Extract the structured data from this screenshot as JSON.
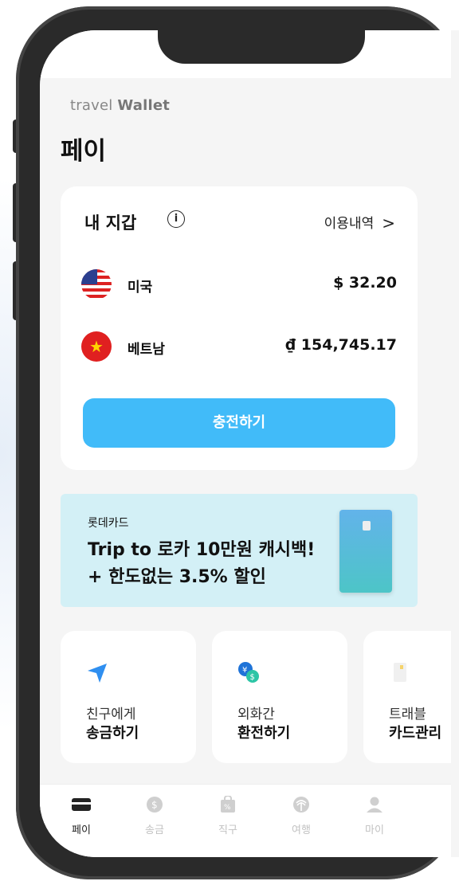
{
  "brand": {
    "prefix": "travel",
    "bold": "Wallet"
  },
  "page_title": "페이",
  "wallet": {
    "title": "내 지갑",
    "info_glyph": "i",
    "history_label": "이용내역",
    "history_chevron": ">",
    "currencies": [
      {
        "flag": "us-flag-icon",
        "name": "미국",
        "amount": "$ 32.20"
      },
      {
        "flag": "vn-flag-icon",
        "name": "베트남",
        "amount": "₫ 154,745.17"
      }
    ],
    "charge_label": "충전하기"
  },
  "banner": {
    "kicker": "롯데카드",
    "line1": "Trip to 로카 10만원 캐시백!",
    "line2": "+ 한도없는 3.5% 할인"
  },
  "tiles": [
    {
      "icon": "paper-plane-icon",
      "sub": "친구에게",
      "main": "송금하기"
    },
    {
      "icon": "currency-exchange-icon",
      "sub": "외화간",
      "main": "환전하기"
    },
    {
      "icon": "card-icon",
      "sub": "트래블",
      "main": "카드관리"
    }
  ],
  "tabs": [
    {
      "icon": "card-icon",
      "label": "페이",
      "active": true
    },
    {
      "icon": "dollar-icon",
      "label": "송금",
      "active": false
    },
    {
      "icon": "shopping-bag-icon",
      "label": "직구",
      "active": false
    },
    {
      "icon": "palm-tree-icon",
      "label": "여행",
      "active": false
    },
    {
      "icon": "user-icon",
      "label": "마이",
      "active": false
    }
  ],
  "colors": {
    "accent": "#41bbf9",
    "banner_bg": "#d3f0f6",
    "screen_bg": "#f5f5f5",
    "bezel": "#2a2a2a"
  }
}
